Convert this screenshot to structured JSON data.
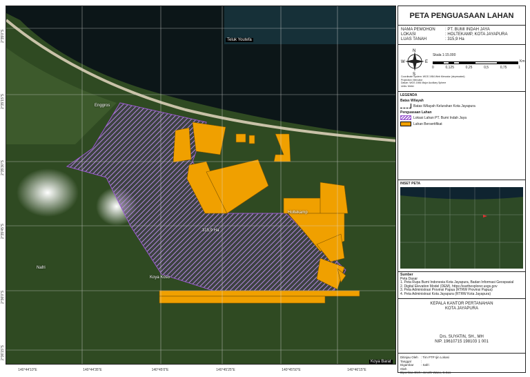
{
  "map": {
    "labels": {
      "bay": "Teluk Youtefa",
      "enggros": "Enggros",
      "holtekamp": "Holtekamp",
      "area": "315,9 Ha",
      "koya_koso": "Koya Koso",
      "nafri": "Nafri",
      "koya_barat": "Koya Barat"
    },
    "x_ticks": [
      "140°44'10\"E",
      "140°44'35\"E",
      "140°45'0\"E",
      "140°45'25\"E",
      "140°45'50\"E",
      "140°46'15\"E"
    ],
    "y_ticks": [
      "2°35'0\"S",
      "2°35'15\"S",
      "2°35'30\"S",
      "2°35'45\"S",
      "2°36'0\"S",
      "2°36'15\"S"
    ],
    "colors": {
      "parcel": "#f0a000",
      "claim": "#9b59d0",
      "land": "#2f4a22",
      "sea": "#0c1618"
    }
  },
  "panel": {
    "title": "PETA PENGUASAAN LAHAN",
    "info": [
      {
        "k": "NAMA PEMOHON",
        "v": ": PT. BUMI INDAH JAYA"
      },
      {
        "k": "LOKASI",
        "v": ": HOLTEKAMP, KOTA JAYAPURA"
      },
      {
        "k": "LUAS TANAH",
        "v": ": 315,9 Ha"
      }
    ],
    "compass": {
      "n": "N",
      "s": "S",
      "e": "E",
      "w": "W"
    },
    "scale": "Skala 1:15.000",
    "scale_ticks": [
      "0",
      "0,125",
      "0,25",
      "0,5",
      "0,75",
      "1"
    ],
    "scale_unit": "Km",
    "crs": [
      "Coordinate System: WGS 1984 Web Mercator (deprecated)",
      "Projection: Mercator",
      "Datum: WGS 1984 Major Auxiliary Sphere",
      "Units: Meter"
    ],
    "legend": {
      "title": "LEGENDA",
      "group1": "Batas Wilayah",
      "item1": "Batas Wilayah Kelurahan Kota Jayapura",
      "group2": "Penguasaan Lahan",
      "item2": "Lokasi Lahan PT. Bumi Indah Jaya",
      "item3": "Lahan Bersertifikat"
    },
    "inset": {
      "title": "INSET PETA"
    },
    "sources": {
      "title": "Sumber",
      "sub": "Peta Dasar",
      "items": [
        "1. Peta Rupa Bumi Indonesia Kota Jayapura, Badan Informasi Geospasial",
        "2. Digital Elevation Model (DEM), https://earthexplorer.usgs.gov",
        "3. Peta Administrasi Provinsi  Papua (RTRW Provinsi Papua)",
        "4. Peta Administrasi Kota Jayapura (RTRW Kota Jayapura)"
      ]
    },
    "sign": {
      "office1": "KEPALA KANTOR PERTANAHAN",
      "office2": "KOTA JAYAPURA",
      "name": "Drs. SUYATIN, SH., MH",
      "nip": "NIP. 19610715 198103 1 001"
    },
    "footer": [
      {
        "k": "Ditinjau Oleh",
        "v": ": Tim PTP Ijin Lokasi"
      },
      {
        "k": "Tanggal",
        "v": ":"
      },
      {
        "k": "Digambar Oleh",
        "v": ": Safri"
      },
      {
        "k": "Diperiksa Oleh",
        "v": ": Jeneth Wano, S.Sos"
      }
    ]
  }
}
